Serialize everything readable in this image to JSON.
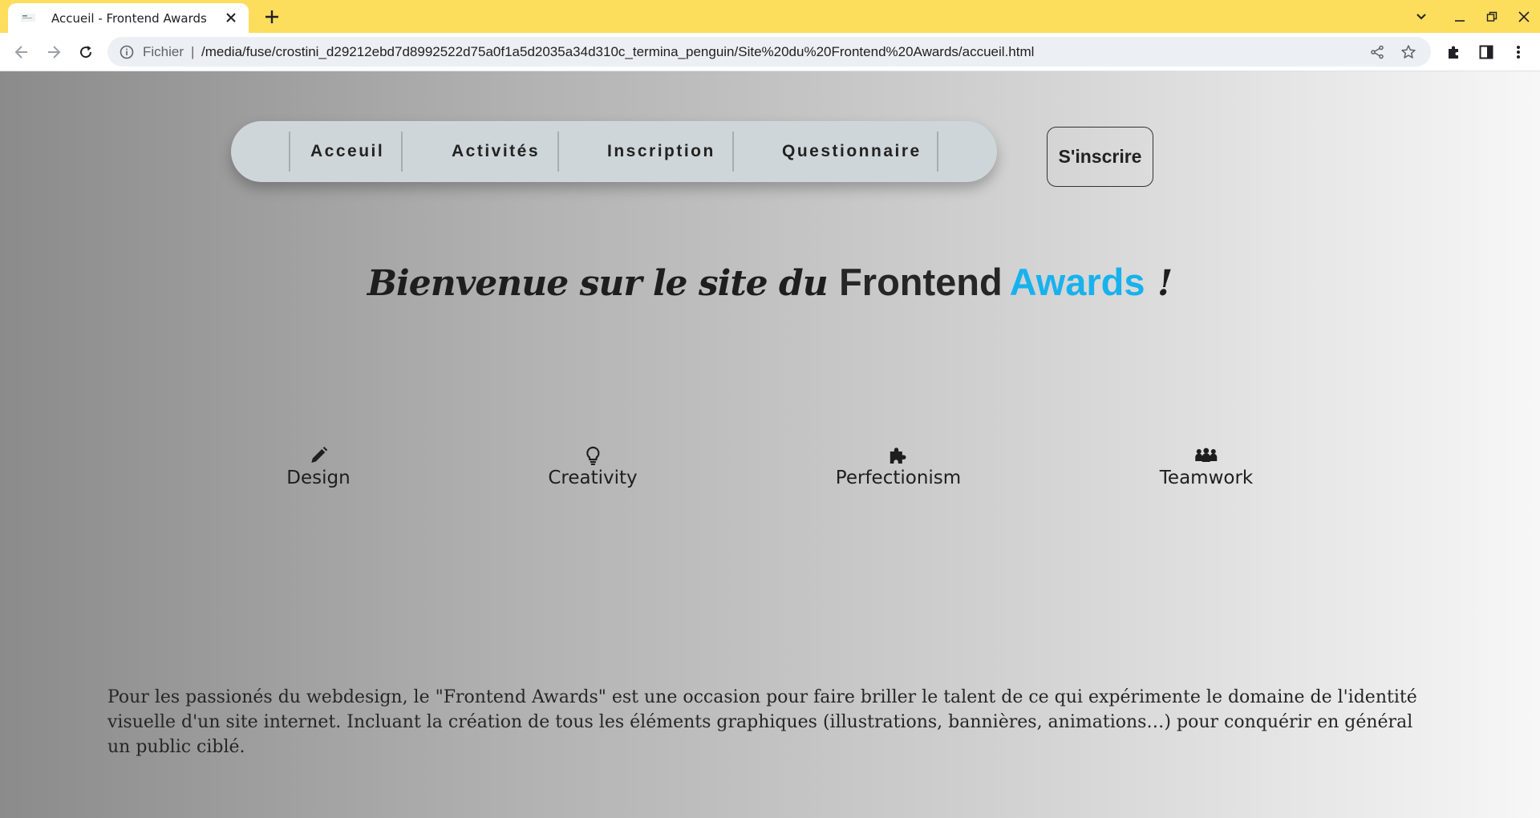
{
  "browser": {
    "tab_title": "Accueil - Frontend Awards",
    "scheme_label": "Fichier",
    "separator": "|",
    "url": "/media/fuse/crostini_d29212ebd7d8992522d75a0f1a5d2035a34d310c_termina_penguin/Site%20du%20Frontend%20Awards/accueil.html",
    "accent_color": "#fddd5c"
  },
  "nav": {
    "items": [
      {
        "label": "Acceuil"
      },
      {
        "label": "Activités"
      },
      {
        "label": "Inscription"
      },
      {
        "label": "Questionnaire"
      }
    ]
  },
  "signup": {
    "label": "S'inscrire"
  },
  "headline": {
    "script_part": "Bienvenue sur le site du ",
    "brand": "Frontend",
    "accent": "Awards",
    "end": " !",
    "accent_color": "#17b2ee"
  },
  "features": [
    {
      "label": "Design",
      "icon": "pencil-icon"
    },
    {
      "label": "Creativity",
      "icon": "lightbulb-icon"
    },
    {
      "label": "Perfectionism",
      "icon": "puzzle-icon"
    },
    {
      "label": "Teamwork",
      "icon": "people-group-icon"
    }
  ],
  "intro": "Pour les passionés du webdesign, le \"Frontend Awards\" est une occasion pour faire briller le talent de ce qui expérimente le domaine de l'identité visuelle d'un site internet. Incluant la création de tous les éléments graphiques (illustrations, bannières, animations…) pour conquérir en général un public ciblé."
}
